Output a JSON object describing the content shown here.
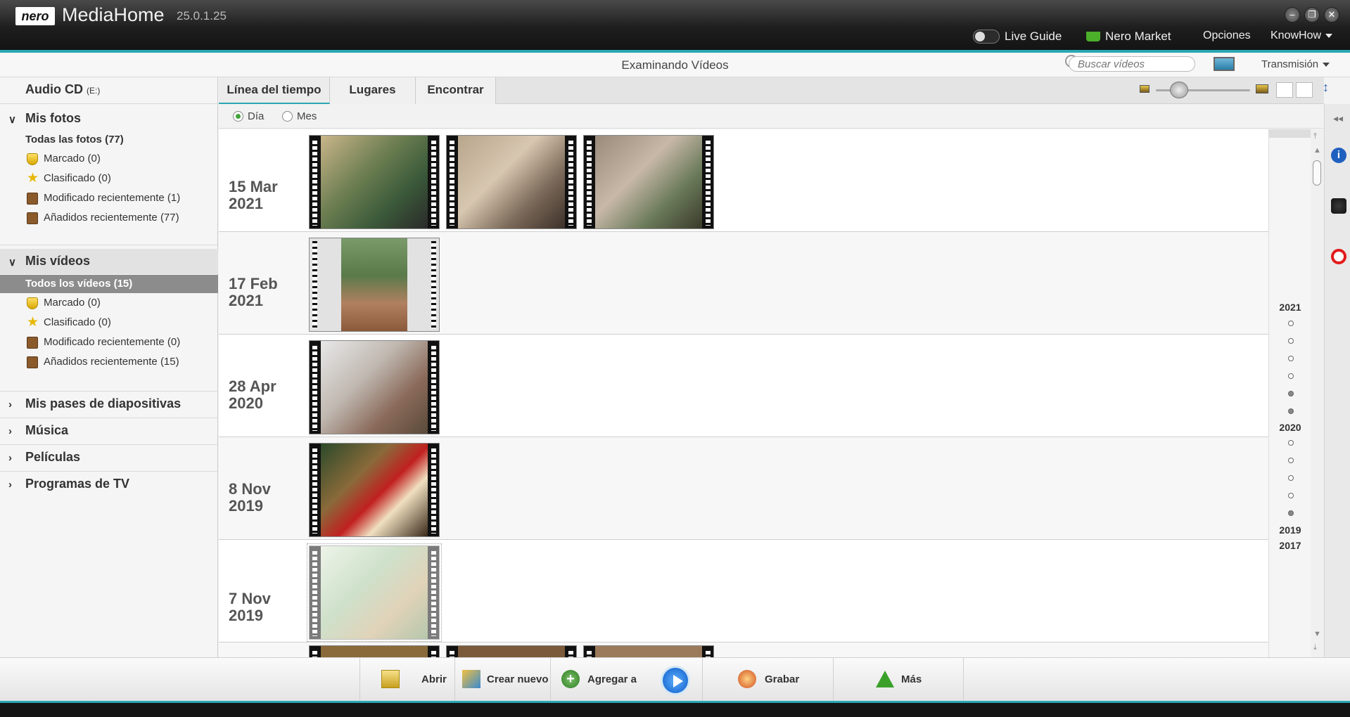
{
  "titlebar": {
    "logo": "nero",
    "app": "MediaHome",
    "version": "25.0.1.25",
    "nav": {
      "live_guide": "Live Guide",
      "market": "Nero Market",
      "options": "Opciones",
      "knowhow": "KnowHow"
    }
  },
  "subbar": {
    "title": "Examinando Vídeos",
    "search_placeholder": "Buscar vídeos",
    "transmission": "Transmisión"
  },
  "sidebar": {
    "audio_cd": {
      "label": "Audio CD",
      "drive": "(E:)"
    },
    "photos": {
      "label": "Mis fotos",
      "all": "Todas las fotos (77)",
      "items": [
        "Marcado (0)",
        "Clasificado (0)",
        "Modificado recientemente (1)",
        "Añadidos recientemente (77)"
      ]
    },
    "videos": {
      "label": "Mis vídeos",
      "all": "Todos los vídeos (15)",
      "items": [
        "Marcado (0)",
        "Clasificado (0)",
        "Modificado recientemente (0)",
        "Añadidos recientemente (15)"
      ]
    },
    "sections": [
      "Mis pases de diapositivas",
      "Música",
      "Películas",
      "Programas de TV"
    ]
  },
  "tabs": [
    "Línea del tiempo",
    "Lugares",
    "Encontrar"
  ],
  "radios": {
    "day": "Día",
    "month": "Mes"
  },
  "timeline": {
    "rows": [
      {
        "date": "15 Mar",
        "year": "2021",
        "thumbs": 3
      },
      {
        "date": "17 Feb",
        "year": "2021",
        "thumbs": 1
      },
      {
        "date": "28 Apr",
        "year": "2020",
        "thumbs": 1
      },
      {
        "date": "8 Nov",
        "year": "2019",
        "thumbs": 1
      },
      {
        "date": "7 Nov",
        "year": "2019",
        "thumbs": 1
      }
    ]
  },
  "yearnav": {
    "years": [
      "2021",
      "2020",
      "2019",
      "2017"
    ]
  },
  "bottombar": {
    "open": "Abrir",
    "create": "Crear nuevo",
    "add": "Agregar a",
    "burn": "Grabar",
    "more": "Más"
  },
  "colors": {
    "accent": "#2aa7b3",
    "selected_bg": "#8c8c8c"
  }
}
